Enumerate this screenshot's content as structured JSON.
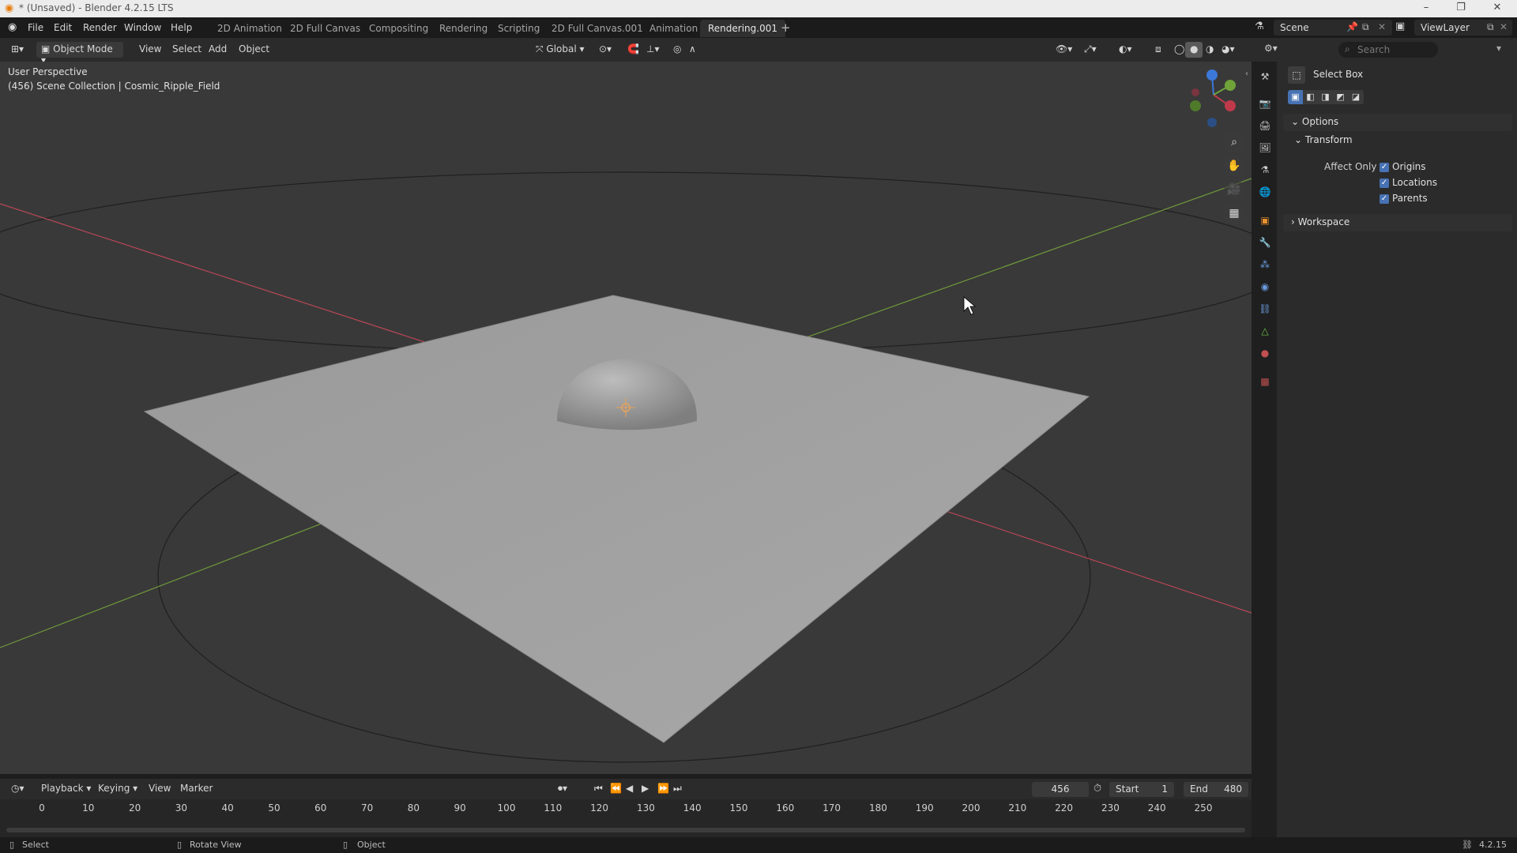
{
  "titlebar": {
    "title": "* (Unsaved) - Blender 4.2.15 LTS"
  },
  "menu": {
    "file": "File",
    "edit": "Edit",
    "render": "Render",
    "window": "Window",
    "help": "Help"
  },
  "workspaces": [
    "2D Animation",
    "2D Full Canvas",
    "Compositing",
    "Rendering",
    "Scripting",
    "2D Full Canvas.001",
    "Animation",
    "Rendering.001"
  ],
  "scene": {
    "name": "Scene",
    "view_layer": "ViewLayer"
  },
  "viewport_header": {
    "mode": "Object Mode",
    "view": "View",
    "select": "Select",
    "add": "Add",
    "object": "Object",
    "orientation": "Global"
  },
  "viewport": {
    "perspective": "User Perspective",
    "collection": "(456) Scene Collection | Cosmic_Ripple_Field"
  },
  "props": {
    "search_placeholder": "Search",
    "tool_name": "Select Box",
    "options": "Options",
    "transform": "Transform",
    "affect_only": "Affect Only",
    "origins": "Origins",
    "locations": "Locations",
    "parents": "Parents",
    "workspace": "Workspace"
  },
  "timeline": {
    "playback": "Playback",
    "keying": "Keying",
    "view": "View",
    "marker": "Marker",
    "current_frame": "456",
    "start_label": "Start",
    "start": "1",
    "end_label": "End",
    "end": "480",
    "ticks": [
      "0",
      "10",
      "20",
      "30",
      "40",
      "50",
      "60",
      "70",
      "80",
      "90",
      "100",
      "110",
      "120",
      "130",
      "140",
      "150",
      "160",
      "170",
      "180",
      "190",
      "200",
      "210",
      "220",
      "230",
      "240",
      "250"
    ]
  },
  "status": {
    "select": "Select",
    "rotate": "Rotate View",
    "object": "Object",
    "version": "4.2.15"
  },
  "colors": {
    "accent": "#4772b3",
    "x_axis": "#c0394a",
    "y_axis": "#6fa33a",
    "z_axis": "#3c78d8"
  }
}
